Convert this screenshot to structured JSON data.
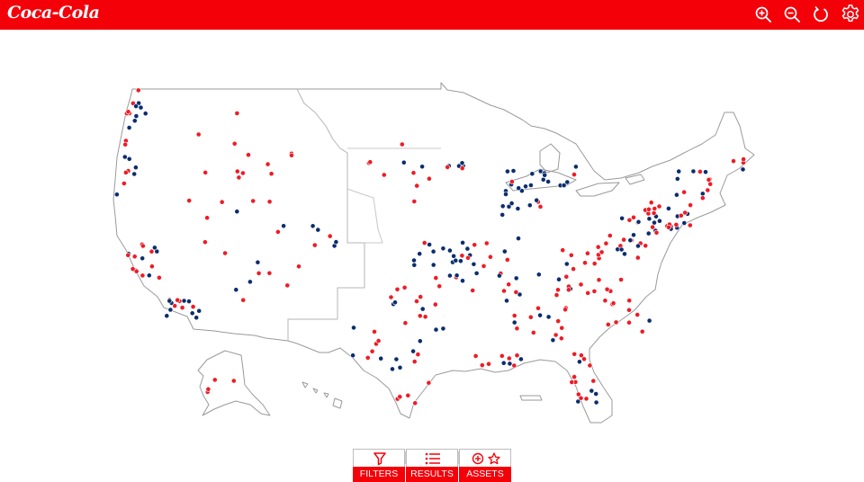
{
  "app": {
    "brand": "Coca-Cola",
    "colors": {
      "brand_red": "#f40009",
      "marker_red": "#ee1c25",
      "marker_blue": "#0b2d6f",
      "map_outline": "#9a9a9a"
    }
  },
  "toolbar": {
    "items": [
      {
        "name": "zoom-in-icon"
      },
      {
        "name": "zoom-out-icon"
      },
      {
        "name": "refresh-icon"
      },
      {
        "name": "settings-gear-icon"
      }
    ]
  },
  "map": {
    "region": "United States",
    "marker_categories": [
      {
        "color": "red"
      },
      {
        "color": "blue"
      }
    ]
  },
  "bottom_panel": {
    "tabs": [
      {
        "label": "FILTERS",
        "icon": "filter-funnel-icon"
      },
      {
        "label": "RESULTS",
        "icon": "list-icon"
      },
      {
        "label": "ASSETS",
        "icon": "add-star-icon"
      }
    ]
  }
}
